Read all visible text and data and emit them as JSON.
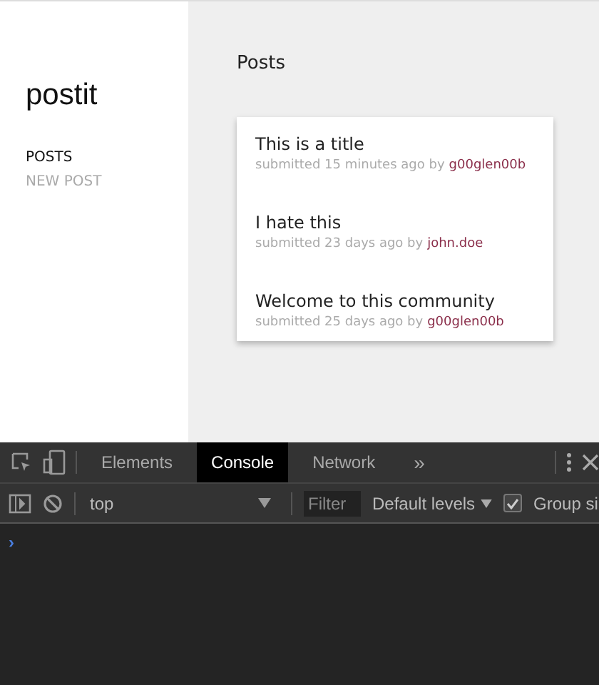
{
  "app": {
    "logo": "postit",
    "nav": [
      {
        "label": "POSTS",
        "selected": true
      },
      {
        "label": "NEW POST",
        "selected": false
      }
    ]
  },
  "main": {
    "heading": "Posts",
    "posts": [
      {
        "title": "This is a title",
        "meta": "submitted 15 minutes ago by",
        "author": "g00glen00b"
      },
      {
        "title": "I hate this",
        "meta": "submitted 23 days ago by",
        "author": "john.doe"
      },
      {
        "title": "Welcome to this community",
        "meta": "submitted 25 days ago by",
        "author": "g00glen00b"
      }
    ]
  },
  "devtools": {
    "tabs": [
      {
        "label": "Elements",
        "selected": false
      },
      {
        "label": "Console",
        "selected": true
      },
      {
        "label": "Network",
        "selected": false
      }
    ],
    "more": "»",
    "context": "top",
    "filter_placeholder": "Filter",
    "levels": "Default levels",
    "group_similar": {
      "label": "Group si",
      "checked": true
    },
    "prompt": "›"
  }
}
